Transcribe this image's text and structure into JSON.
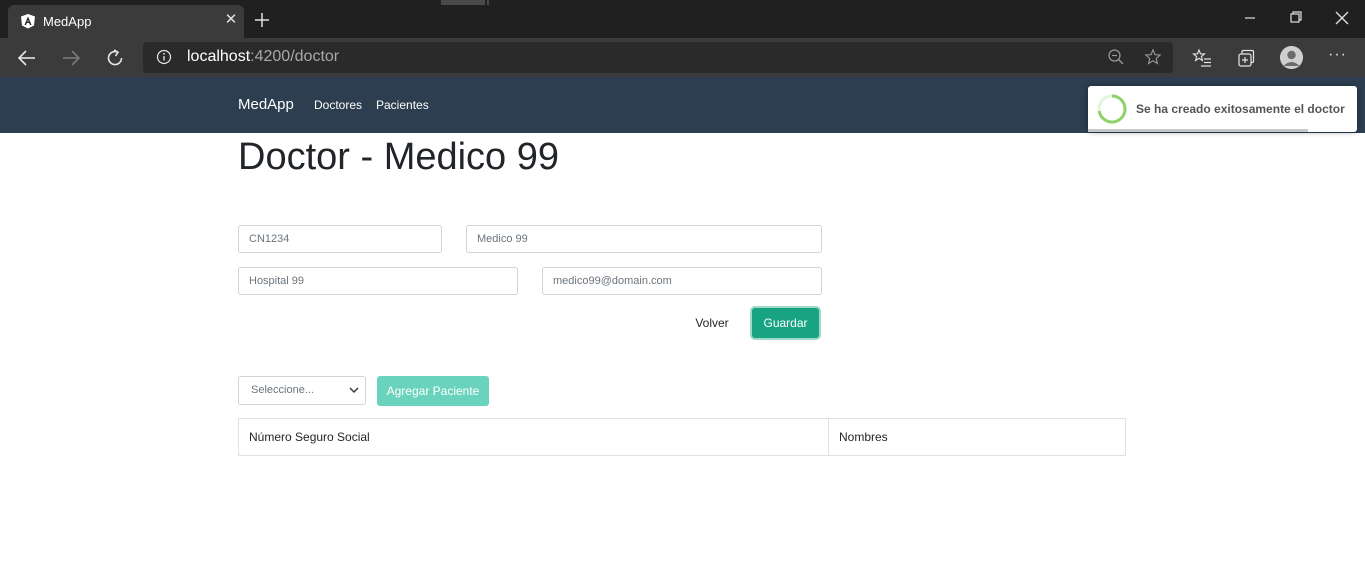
{
  "browser": {
    "tab_title": "MedApp",
    "tab_close": "✕",
    "url_host": "localhost",
    "url_path": ":4200/doctor",
    "more_menu": "···"
  },
  "navbar": {
    "brand": "MedApp",
    "links": [
      "Doctores",
      "Pacientes"
    ]
  },
  "page": {
    "title": "Doctor - Medico 99"
  },
  "form": {
    "field_code": "CN1234",
    "field_name": "Medico 99",
    "field_hospital": "Hospital 99",
    "field_email": "medico99@domain.com",
    "volver_label": "Volver",
    "guardar_label": "Guardar"
  },
  "patients": {
    "select_placeholder": "Seleccione...",
    "add_label": "Agregar Paciente",
    "columns": [
      "Número Seguro Social",
      "Nombres"
    ]
  },
  "toast": {
    "message": "Se ha creado exitosamente el doctor"
  },
  "colors": {
    "navbar": "#2c3e50",
    "primary": "#18a383",
    "primary_disabled": "#6ad3be",
    "spinner": "#8fd16a"
  }
}
